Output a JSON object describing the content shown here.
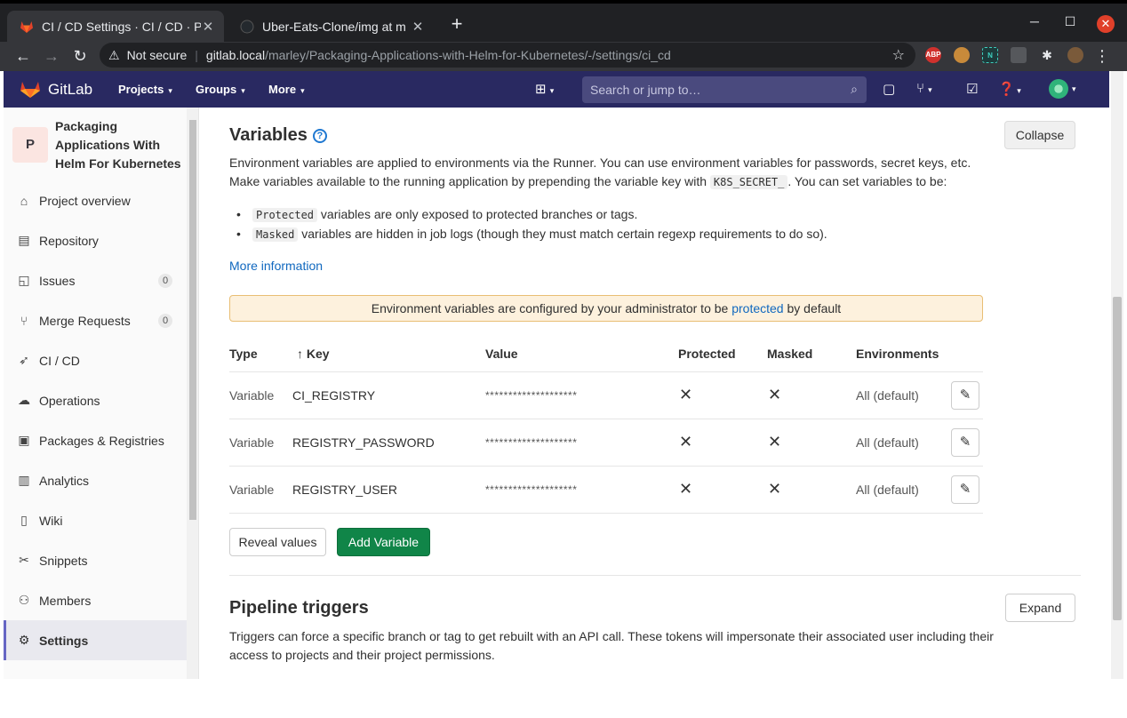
{
  "browser": {
    "tabs": [
      {
        "title": "CI / CD Settings · CI / CD · P",
        "close": "✕"
      },
      {
        "title": "Uber-Eats-Clone/img at m",
        "close": "✕"
      }
    ],
    "new_tab": "+",
    "omnibox": {
      "security": "Not secure",
      "host": "gitlab.local",
      "path": "/marley/Packaging-Applications-with-Helm-for-Kubernetes/-/settings/ci_cd"
    },
    "extensions": [
      "ABP",
      "cookie",
      "N",
      "grid",
      "puzzle",
      "profile"
    ]
  },
  "header": {
    "brand": "GitLab",
    "nav": [
      "Projects",
      "Groups",
      "More"
    ],
    "search_placeholder": "Search or jump to…"
  },
  "sidebar": {
    "avatar_letter": "P",
    "project_name": "Packaging Applications With Helm For Kubernetes",
    "items": [
      {
        "label": "Project overview",
        "icon": "home-icon"
      },
      {
        "label": "Repository",
        "icon": "doc-icon"
      },
      {
        "label": "Issues",
        "icon": "issues-icon",
        "badge": "0"
      },
      {
        "label": "Merge Requests",
        "icon": "merge-icon",
        "badge": "0"
      },
      {
        "label": "CI / CD",
        "icon": "rocket-icon"
      },
      {
        "label": "Operations",
        "icon": "cloud-icon"
      },
      {
        "label": "Packages & Registries",
        "icon": "package-icon"
      },
      {
        "label": "Analytics",
        "icon": "chart-icon"
      },
      {
        "label": "Wiki",
        "icon": "book-icon"
      },
      {
        "label": "Snippets",
        "icon": "scissors-icon"
      },
      {
        "label": "Members",
        "icon": "users-icon"
      },
      {
        "label": "Settings",
        "icon": "gear-icon"
      }
    ]
  },
  "variables": {
    "title": "Variables",
    "collapse_label": "Collapse",
    "desc_1": "Environment variables are applied to environments via the Runner. You can use environment variables for passwords, secret keys, etc.",
    "desc_2a": "Make variables available to the running application by prepending the variable key with",
    "desc_2_code": "K8S_SECRET_",
    "desc_2b": ". You can set variables to be:",
    "bullet_1_code": "Protected",
    "bullet_1_text": "variables are only exposed to protected branches or tags.",
    "bullet_2_code": "Masked",
    "bullet_2_text": "variables are hidden in job logs (though they must match certain regexp requirements to do so).",
    "more_info": "More information",
    "alert_a": "Environment variables are configured by your administrator to be",
    "alert_link": "protected",
    "alert_b": "by default",
    "columns": [
      "Type",
      "↑ Key",
      "Value",
      "Protected",
      "Masked",
      "Environments"
    ],
    "rows": [
      {
        "type": "Variable",
        "key": "CI_REGISTRY",
        "value": "********************",
        "protected": "✕",
        "masked": "✕",
        "env": "All (default)"
      },
      {
        "type": "Variable",
        "key": "REGISTRY_PASSWORD",
        "value": "********************",
        "protected": "✕",
        "masked": "✕",
        "env": "All (default)"
      },
      {
        "type": "Variable",
        "key": "REGISTRY_USER",
        "value": "********************",
        "protected": "✕",
        "masked": "✕",
        "env": "All (default)"
      }
    ],
    "reveal_label": "Reveal values",
    "add_label": "Add Variable"
  },
  "triggers": {
    "title": "Pipeline triggers",
    "expand_label": "Expand",
    "desc": "Triggers can force a specific branch or tag to get rebuilt with an API call. These tokens will impersonate their associated user including their access to projects and their project permissions."
  },
  "colors": {
    "header_bg": "#292961",
    "accent_blue": "#1068bf",
    "add_button": "#108548",
    "alert_bg": "#fdf1dd"
  }
}
